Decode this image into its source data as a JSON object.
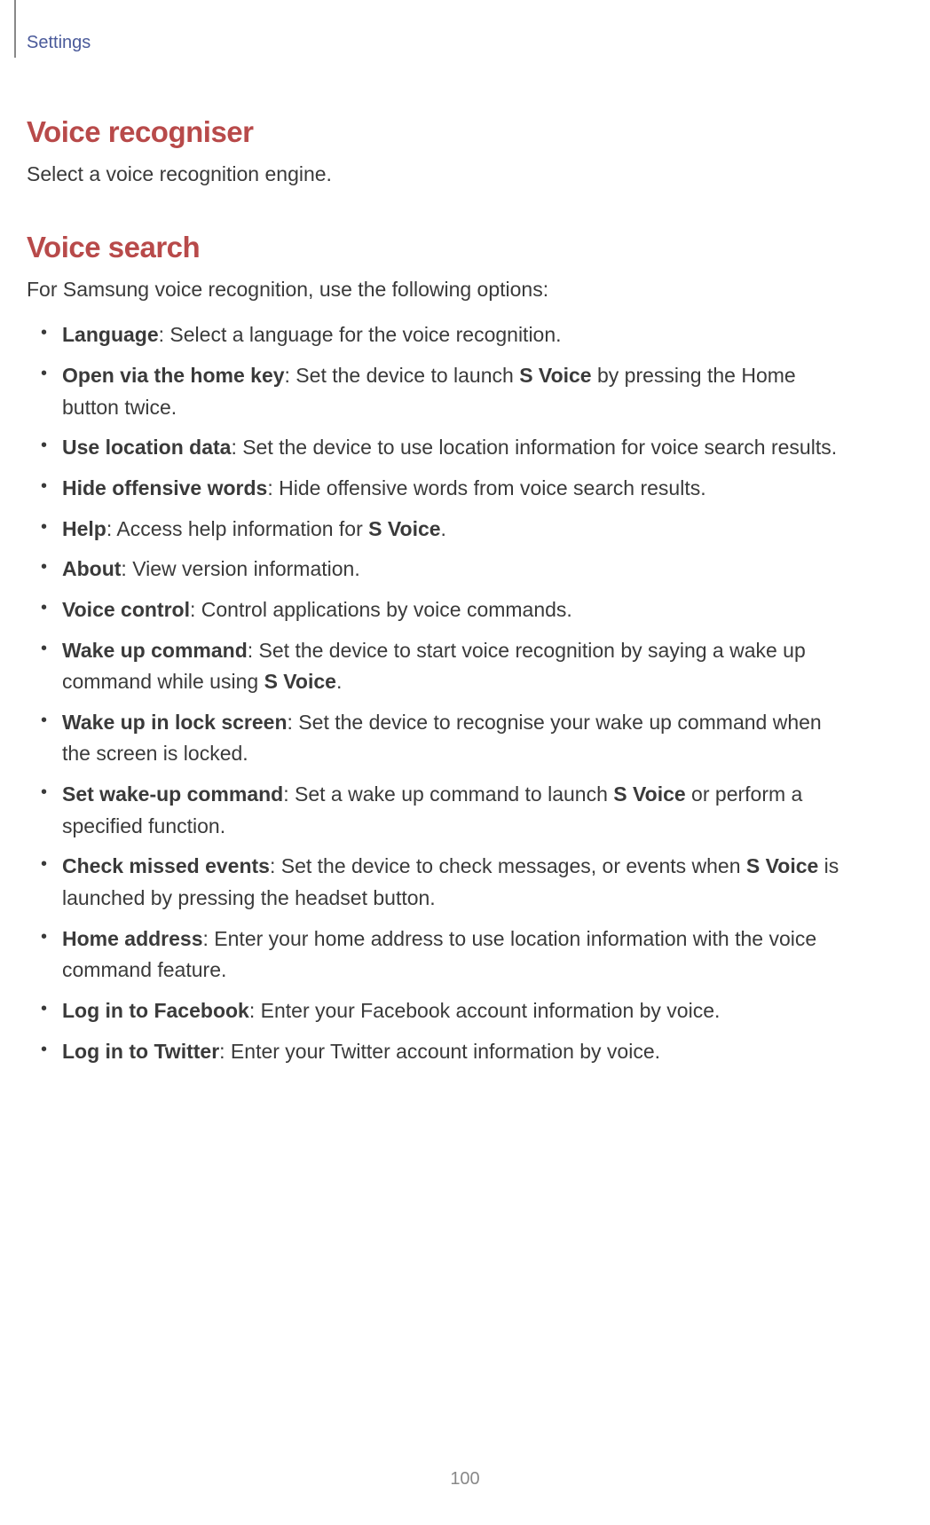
{
  "header": {
    "breadcrumb": "Settings"
  },
  "sections": {
    "voice_recogniser": {
      "title": "Voice recogniser",
      "desc": "Select a voice recognition engine."
    },
    "voice_search": {
      "title": "Voice search",
      "intro": "For Samsung voice recognition, use the following options:",
      "items": [
        {
          "term": "Language",
          "desc": ": Select a language for the voice recognition."
        },
        {
          "term": "Open via the home key",
          "pre": ": Set the device to launch ",
          "bold": "S Voice",
          "post": " by pressing the Home button twice."
        },
        {
          "term": "Use location data",
          "desc": ": Set the device to use location information for voice search results."
        },
        {
          "term": "Hide offensive words",
          "desc": ": Hide offensive words from voice search results."
        },
        {
          "term": "Help",
          "pre": ": Access help information for ",
          "bold": "S Voice",
          "post": "."
        },
        {
          "term": "About",
          "desc": ": View version information."
        },
        {
          "term": "Voice control",
          "desc": ": Control applications by voice commands."
        },
        {
          "term": "Wake up command",
          "pre": ": Set the device to start voice recognition by saying a wake up command while using ",
          "bold": "S Voice",
          "post": "."
        },
        {
          "term": "Wake up in lock screen",
          "desc": ": Set the device to recognise your wake up command when the screen is locked."
        },
        {
          "term": "Set wake-up command",
          "pre": ": Set a wake up command to launch ",
          "bold": "S Voice",
          "post": " or perform a specified function."
        },
        {
          "term": "Check missed events",
          "pre": ": Set the device to check messages, or events when ",
          "bold": "S Voice",
          "post": " is launched by pressing the headset button."
        },
        {
          "term": "Home address",
          "desc": ": Enter your home address to use location information with the voice command feature."
        },
        {
          "term": "Log in to Facebook",
          "desc": ": Enter your Facebook account information by voice."
        },
        {
          "term": "Log in to Twitter",
          "desc": ": Enter your Twitter account information by voice."
        }
      ]
    }
  },
  "page_number": "100"
}
